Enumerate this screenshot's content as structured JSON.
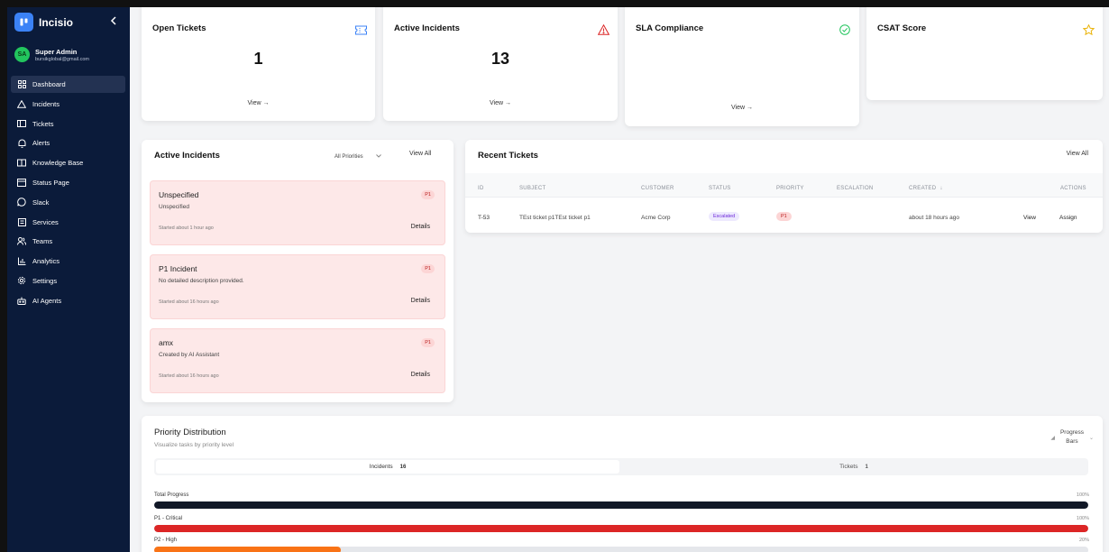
{
  "app": {
    "name": "Incisio",
    "collapse_icon": "chevron-left-icon"
  },
  "user": {
    "initials": "SA",
    "name": "Super Admin",
    "email": "bursikglobal@gmail.com"
  },
  "sidebar": {
    "items": [
      {
        "label": "Dashboard",
        "icon": "grid-icon",
        "active": true
      },
      {
        "label": "Incidents",
        "icon": "alert-triangle-icon"
      },
      {
        "label": "Tickets",
        "icon": "ticket-icon"
      },
      {
        "label": "Alerts",
        "icon": "bell-icon"
      },
      {
        "label": "Knowledge Base",
        "icon": "book-icon"
      },
      {
        "label": "Status Page",
        "icon": "status-icon"
      },
      {
        "label": "Slack",
        "icon": "chat-icon"
      },
      {
        "label": "Services",
        "icon": "server-icon"
      },
      {
        "label": "Teams",
        "icon": "users-icon"
      },
      {
        "label": "Analytics",
        "icon": "bar-chart-icon"
      },
      {
        "label": "Settings",
        "icon": "gear-icon"
      },
      {
        "label": "AI Agents",
        "icon": "robot-icon"
      }
    ]
  },
  "stats": {
    "open_tickets": {
      "title": "Open Tickets",
      "value": "1",
      "link": "View →",
      "icon": "ticket-icon"
    },
    "active_incidents": {
      "title": "Active Incidents",
      "value": "13",
      "link": "View →",
      "icon": "warning-icon"
    },
    "sla": {
      "title": "SLA Compliance",
      "link": "View →",
      "icon": "check-circle-icon"
    },
    "csat": {
      "title": "CSAT Score",
      "icon": "star-icon"
    }
  },
  "active_panel": {
    "title": "Active Incidents",
    "filter": "All Priorities",
    "view_all": "View All",
    "items": [
      {
        "title": "Unspecified",
        "desc": "Unspecified",
        "time": "Started about 1 hour ago",
        "priority": "P1",
        "action": "Details"
      },
      {
        "title": "P1 Incident",
        "desc": "No detailed description provided.",
        "time": "Started about 16 hours ago",
        "priority": "P1",
        "action": "Details"
      },
      {
        "title": "amx",
        "desc": "Created by AI Assistant",
        "time": "Started about 16 hours ago",
        "priority": "P1",
        "action": "Details"
      }
    ]
  },
  "tickets_panel": {
    "title": "Recent Tickets",
    "view_all": "View All",
    "columns": [
      "ID",
      "SUBJECT",
      "CUSTOMER",
      "STATUS",
      "PRIORITY",
      "ESCALATION",
      "CREATED",
      "ACTIONS"
    ],
    "rows": [
      {
        "id": "T-53",
        "subject": "TEst ticket p1TEst ticket p1",
        "customer": "Acme Corp",
        "status": "Escalated",
        "priority": "P1",
        "created": "about 18 hours ago",
        "view": "View",
        "assign": "Assign"
      }
    ]
  },
  "priority": {
    "title": "Priority Distribution",
    "subtitle": "Visualize tasks by priority level",
    "mode_line1": "Progress",
    "mode_line2": "Bars",
    "tabs": [
      {
        "label": "Incidents",
        "count": "16"
      },
      {
        "label": "Tickets",
        "count": "1"
      }
    ],
    "bars": [
      {
        "label": "Total Progress",
        "percent": 100,
        "pct_label": "100%",
        "color": "#111827"
      },
      {
        "label": "P1 - Critical",
        "percent": 100,
        "pct_label": "100%",
        "color": "#dc2626"
      },
      {
        "label": "P2 - High",
        "percent": 20,
        "pct_label": "20%",
        "color": "#f97316"
      }
    ]
  }
}
